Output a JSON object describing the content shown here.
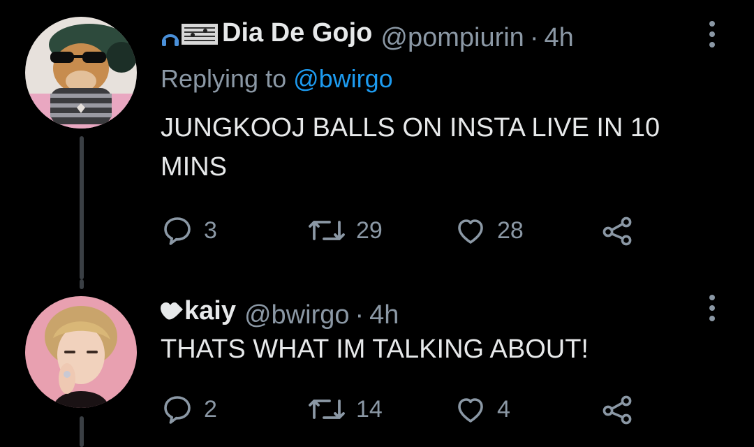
{
  "tweets": [
    {
      "prefix_icons": [
        "music-note-icon",
        "music-score-icon"
      ],
      "display_name": "Dia De Gojo",
      "handle": "@pompiurin",
      "separator": "·",
      "time": "4h",
      "replying_label": "Replying to ",
      "replying_to": "@bwirgo",
      "text": "JUNGKOOJ BALLS ON INSTA LIVE IN 10 MINS",
      "replies": "3",
      "retweets": "29",
      "likes": "28"
    },
    {
      "prefix_icons": [
        "heart-arrow-icon"
      ],
      "display_name": "kaiy",
      "handle": "@bwirgo",
      "separator": "·",
      "time": "4h",
      "text": "THATS WHAT IM TALKING ABOUT!",
      "replies": "2",
      "retweets": "14",
      "likes": "4"
    }
  ],
  "colors": {
    "background": "#000000",
    "text": "#e7e9ea",
    "secondary": "#8b98a5",
    "link": "#1d9bf0",
    "thread_line": "#3a3f44"
  }
}
